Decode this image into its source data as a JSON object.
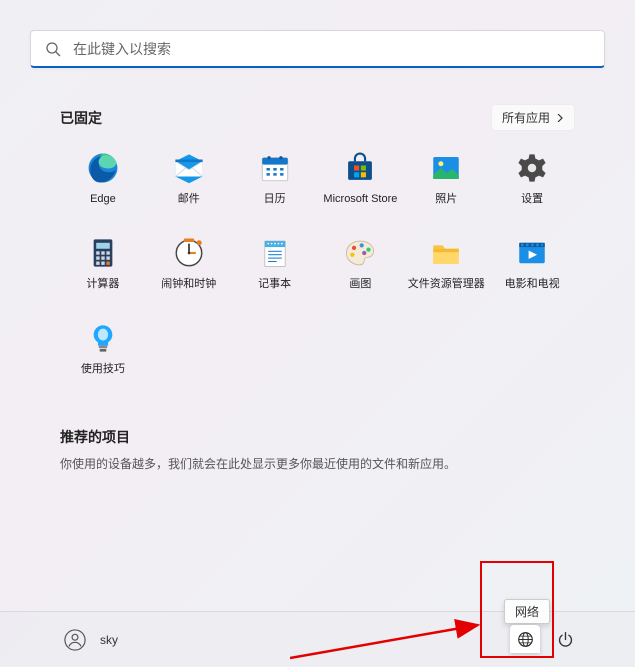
{
  "search": {
    "placeholder": "在此键入以搜索"
  },
  "pinned": {
    "title": "已固定",
    "allApps": "所有应用",
    "items": [
      {
        "label": "Edge",
        "icon": "edge"
      },
      {
        "label": "邮件",
        "icon": "mail"
      },
      {
        "label": "日历",
        "icon": "calendar"
      },
      {
        "label": "Microsoft Store",
        "icon": "store"
      },
      {
        "label": "照片",
        "icon": "photos"
      },
      {
        "label": "设置",
        "icon": "settings"
      },
      {
        "label": "计算器",
        "icon": "calculator"
      },
      {
        "label": "闹钟和时钟",
        "icon": "clock"
      },
      {
        "label": "记事本",
        "icon": "notepad"
      },
      {
        "label": "画图",
        "icon": "paint"
      },
      {
        "label": "文件资源管理器",
        "icon": "explorer"
      },
      {
        "label": "电影和电视",
        "icon": "movies"
      },
      {
        "label": "使用技巧",
        "icon": "tips"
      }
    ]
  },
  "recommended": {
    "title": "推荐的项目",
    "empty": "你使用的设备越多，我们就会在此处显示更多你最近使用的文件和新应用。"
  },
  "user": {
    "name": "sky"
  },
  "tray": {
    "networkTooltip": "网络"
  }
}
